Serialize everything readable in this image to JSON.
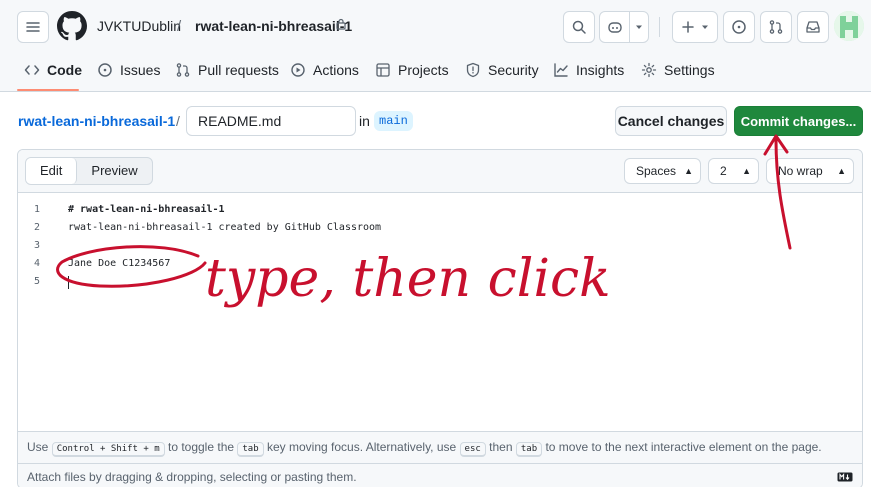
{
  "header": {
    "owner": "JVKTUDublin",
    "separator": "/",
    "repo": "rwat-lean-ni-bhreasail-1"
  },
  "nav": {
    "items": [
      {
        "label": "Code",
        "icon": "code-icon"
      },
      {
        "label": "Issues",
        "icon": "issue-icon"
      },
      {
        "label": "Pull requests",
        "icon": "pull-request-icon"
      },
      {
        "label": "Actions",
        "icon": "play-icon"
      },
      {
        "label": "Projects",
        "icon": "table-icon"
      },
      {
        "label": "Security",
        "icon": "shield-icon"
      },
      {
        "label": "Insights",
        "icon": "graph-icon"
      },
      {
        "label": "Settings",
        "icon": "gear-icon"
      }
    ],
    "active": "Code"
  },
  "edit": {
    "repo_link": "rwat-lean-ni-bhreasail-1",
    "slash": "/",
    "filename": "README.md",
    "in_label": "in",
    "branch": "main",
    "cancel_label": "Cancel changes",
    "commit_label": "Commit changes..."
  },
  "editor": {
    "tabs": {
      "edit": "Edit",
      "preview": "Preview"
    },
    "indent_mode": "Spaces",
    "indent_size": "2",
    "wrap_mode": "No wrap",
    "lines": [
      {
        "num": "1",
        "text": "# rwat-lean-ni-bhreasail-1"
      },
      {
        "num": "2",
        "text": "rwat-lean-ni-bhreasail-1 created by GitHub Classroom"
      },
      {
        "num": "3",
        "text": ""
      },
      {
        "num": "4",
        "text": "Jane Doe C1234567"
      },
      {
        "num": "5",
        "text": ""
      }
    ],
    "footer": {
      "use": "Use",
      "key1": "Control + Shift + m",
      "t1": "to toggle the",
      "key2": "tab",
      "t2": "key moving focus. Alternatively, use",
      "key3": "esc",
      "t3": "then",
      "key4": "tab",
      "t4": "to move to the next interactive element on the page."
    },
    "attach": "Attach files by dragging & dropping, selecting or pasting them."
  },
  "annotation": {
    "text": "type, then click",
    "color": "#c8102e"
  },
  "colors": {
    "primary_green": "#1f883d",
    "link_blue": "#0969da",
    "nav_underline": "#fd8c73"
  }
}
